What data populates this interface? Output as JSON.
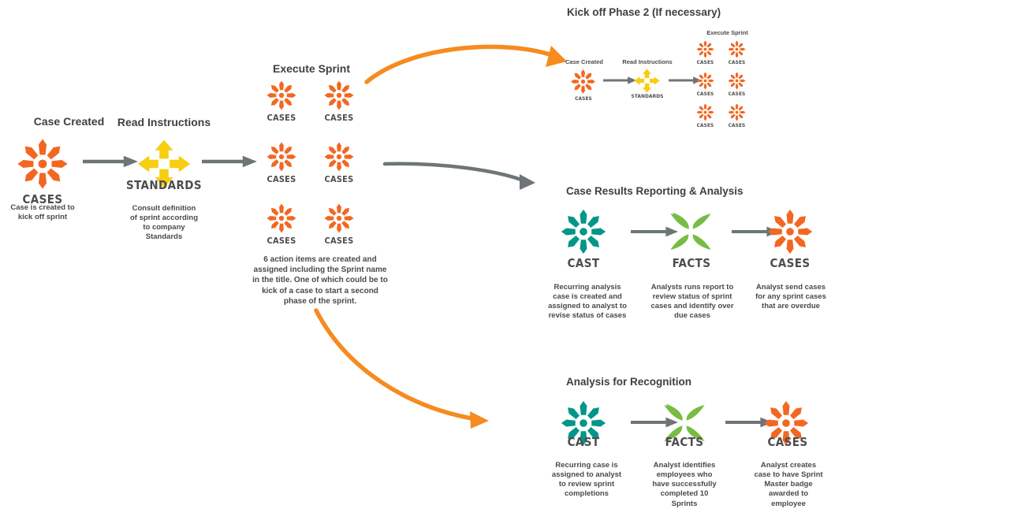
{
  "palette": {
    "orange": "#F26722",
    "orange_arrow": "#F68B1F",
    "yellow": "#F8CE11",
    "teal": "#009688",
    "teal_dark": "#00897B",
    "green": "#77BC43",
    "gray_arrow": "#6E7577",
    "text": "#3f3f3f",
    "label_text": "#4d4d4d",
    "background": "#ffffff"
  },
  "main_flow": {
    "stages": [
      {
        "title": "Case Created",
        "icon": "cases-starburst-icon",
        "icon_label": "CASES",
        "caption": "Case is created to\nkick off sprint"
      },
      {
        "title": "Read Instructions",
        "icon": "standards-diamond-arrows-icon",
        "icon_label": "STANDARDS",
        "caption": "Consult definition\nof sprint according\nto company\nStandards"
      },
      {
        "title": "Execute Sprint",
        "icon": "cases-starburst-icon",
        "icon_label": "CASES",
        "icon_count": 6,
        "caption": "6 action items are created and\nassigned including the Sprint name\nin the title. One of which could be to\nkick of a case to start a second\nphase of the sprint."
      }
    ],
    "connectors": [
      {
        "name": "arrow-case-created-to-read-instructions",
        "style": "straight-gray"
      },
      {
        "name": "arrow-read-instructions-to-execute-sprint",
        "style": "straight-gray"
      },
      {
        "name": "arrow-execute-sprint-to-phase-2",
        "style": "curved-orange"
      },
      {
        "name": "arrow-execute-sprint-to-case-results",
        "style": "curved-gray"
      },
      {
        "name": "arrow-execute-sprint-to-recognition",
        "style": "curved-orange"
      }
    ]
  },
  "phase2": {
    "title": "Kick off Phase 2 (If necessary)",
    "stages": [
      {
        "title": "Case Created",
        "icon": "cases-starburst-icon",
        "icon_label": "CASES"
      },
      {
        "title": "Read Instructions",
        "icon": "standards-diamond-arrows-icon",
        "icon_label": "STANDARDS"
      },
      {
        "title": "Execute Sprint",
        "icon": "cases-starburst-icon",
        "icon_label": "CASES",
        "icon_count": 6
      }
    ]
  },
  "case_results": {
    "title": "Case Results Reporting & Analysis",
    "steps": [
      {
        "icon": "cast-starburst-icon",
        "icon_label": "CAST",
        "caption": "Recurring analysis\ncase is created and\nassigned to analyst to\nrevise status of cases"
      },
      {
        "icon": "facts-pinwheel-icon",
        "icon_label": "FACTS",
        "caption": "Analysts runs report to\nreview status of sprint\ncases and identify over\ndue cases"
      },
      {
        "icon": "cases-starburst-icon",
        "icon_label": "CASES",
        "caption": "Analyst send cases\nfor any sprint cases\nthat are overdue"
      }
    ]
  },
  "recognition": {
    "title": "Analysis for Recognition",
    "steps": [
      {
        "icon": "cast-starburst-icon",
        "icon_label": "CAST",
        "caption": "Recurring case is\nassigned to analyst\nto review sprint\ncompletions"
      },
      {
        "icon": "facts-pinwheel-icon",
        "icon_label": "FACTS",
        "caption": "Analyst identifies\nemployees who\nhave successfully\ncompleted 10\nSprints"
      },
      {
        "icon": "cases-starburst-icon",
        "icon_label": "CASES",
        "caption": "Analyst creates\ncase to have Sprint\nMaster badge\nawarded to\nemployee"
      }
    ]
  }
}
